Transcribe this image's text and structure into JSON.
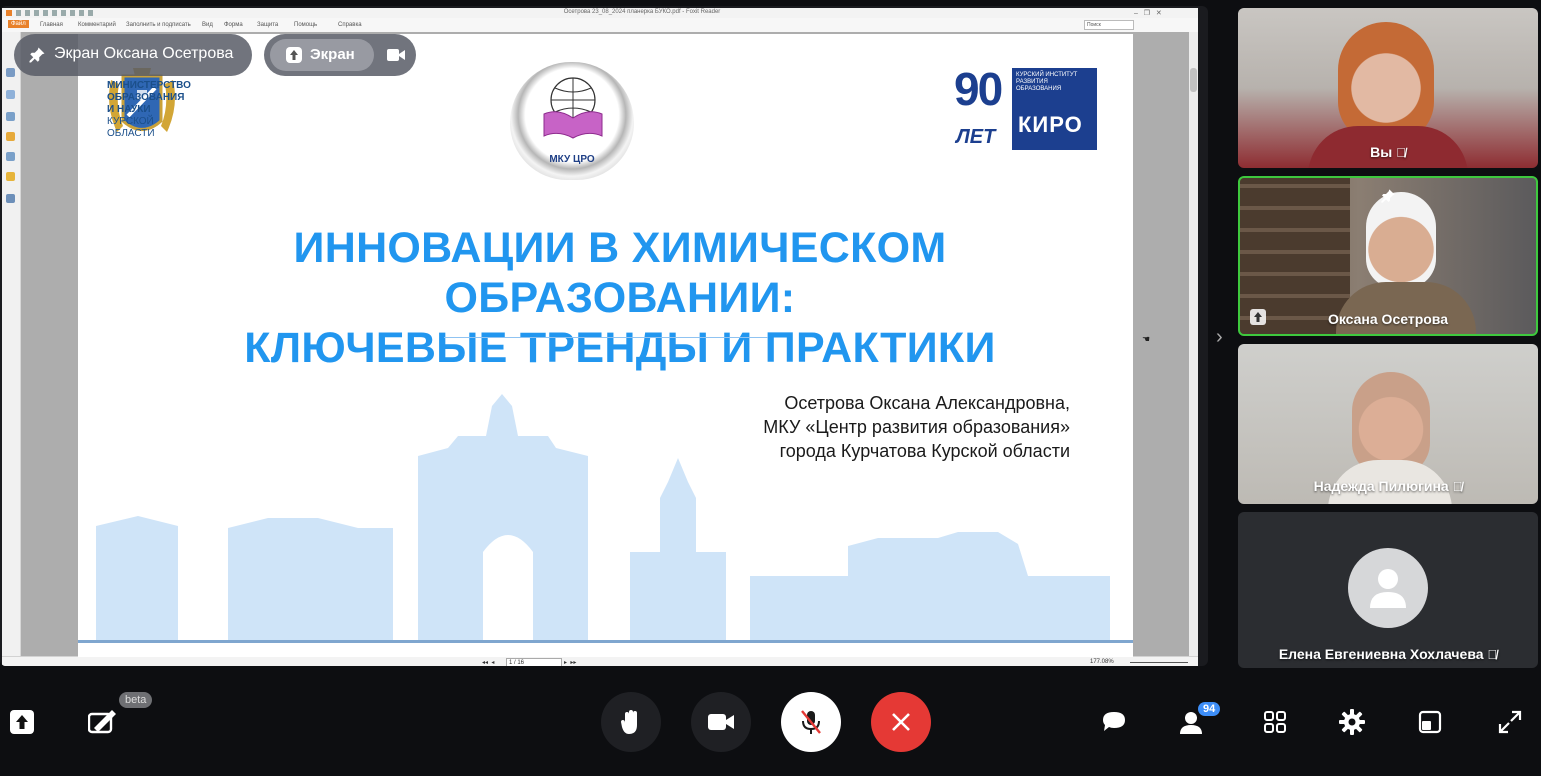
{
  "reader": {
    "window_title": "Осетрова 23_08_2024 планерка БУКО.pdf - Foxit Reader",
    "ribbon_tabs": [
      "Файл",
      "Главная",
      "Комментарий",
      "Заполнить и подписать",
      "Вид",
      "Форма",
      "Защита",
      "Помощь",
      "Справка"
    ],
    "search_placeholder": "Поиск",
    "page_indicator": "1 / 16",
    "zoom": "177.08%"
  },
  "slide": {
    "ministry_lines": [
      "МИНИСТЕРСТВО",
      "ОБРАЗОВАНИЯ",
      "И НАУКИ"
    ],
    "region_lines": [
      "КУРСКОЙ",
      "ОБЛАСТИ"
    ],
    "center_logo_text": "МКУ ЦРО",
    "kiro_top": "КУРСКИЙ ИНСТИТУТ РАЗВИТИЯ ОБРАЗОВАНИЯ",
    "kiro_years": "ЛЕТ",
    "kiro_name": "КИРО",
    "title_line1": "ИННОВАЦИИ В ХИМИЧЕСКОМ ОБРАЗОВАНИИ:",
    "title_line2": "КЛЮЧЕВЫЕ ТРЕНДЫ И ПРАКТИКИ",
    "author_line1": "Осетрова Оксана Александровна,",
    "author_line2": "МКУ «Центр развития образования»",
    "author_line3": "города Курчатова Курской области"
  },
  "overlay": {
    "pinned_label": "Экран Оксана Осетрова",
    "screen_button": "Экран"
  },
  "participants": [
    {
      "name": "Вы",
      "muted": true
    },
    {
      "name": "Оксана Осетрова",
      "pinned": true,
      "sharing": true,
      "active": true
    },
    {
      "name": "Надежда Пилюгина",
      "muted": true
    },
    {
      "name": "Елена Евгениевна Хохлачева",
      "muted": true,
      "no_video": true
    }
  ],
  "toolbar": {
    "beta_badge": "beta",
    "participants_count": "94",
    "colors": {
      "end_call": "#e53935",
      "active_border": "#3ec93e",
      "accent": "#2196ef",
      "badge": "#3d8ef8"
    }
  }
}
